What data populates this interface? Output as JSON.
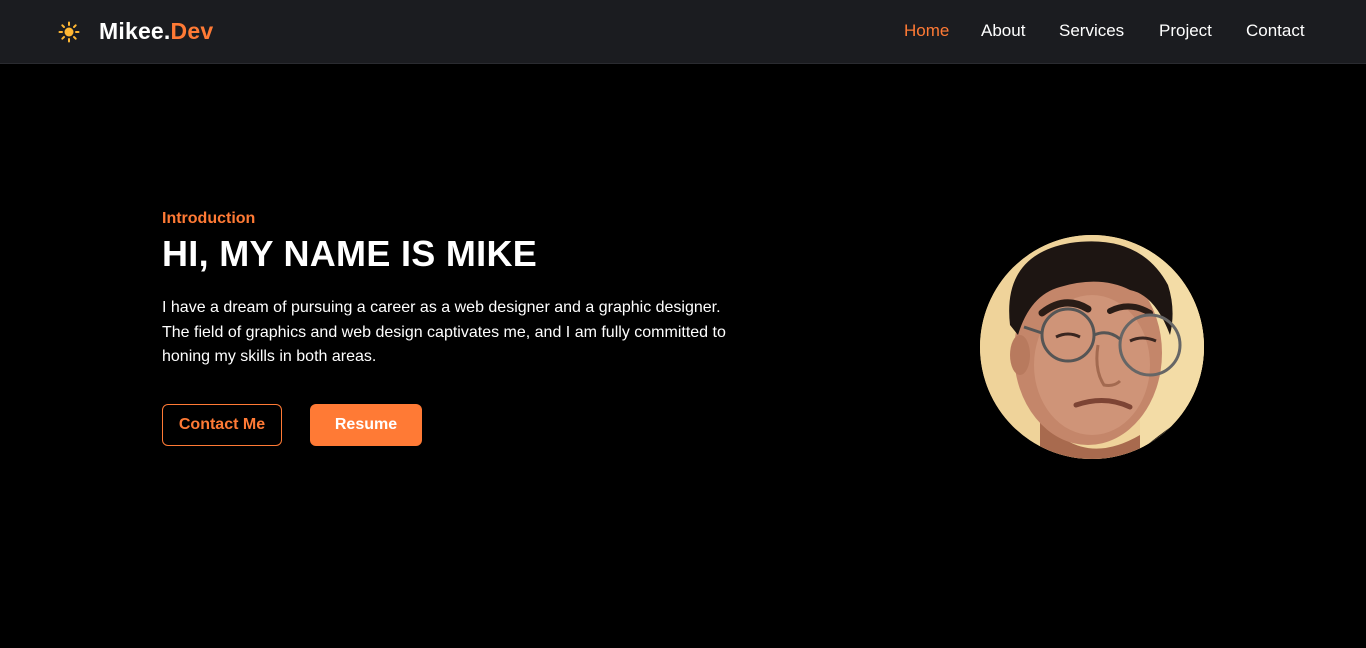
{
  "colors": {
    "accent": "#ff7a35",
    "navbar_bg": "#1b1c20",
    "page_bg": "#000000",
    "text": "#ffffff"
  },
  "header": {
    "theme_icon": "sun-icon",
    "logo_main": "Mikee.",
    "logo_accent": "Dev",
    "nav": {
      "home": "Home",
      "about": "About",
      "services": "Services",
      "project": "Project",
      "contact": "Contact"
    },
    "active_nav": "Home"
  },
  "hero": {
    "intro": "Introduction",
    "title": "HI, MY NAME IS MIKE",
    "description_lines": [
      "I have a dream of pursuing a career as a web designer and a graphic designer.",
      "The field of graphics and web design captivates me, and I am fully committed to",
      "honing my skills in both areas."
    ],
    "contact_button": "Contact Me",
    "resume_button": "Resume",
    "avatar_icon": "profile-photo"
  }
}
